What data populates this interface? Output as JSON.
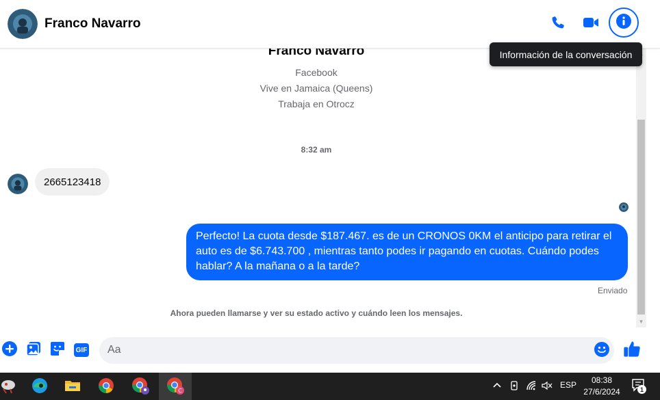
{
  "header": {
    "contact_name": "Franco Navarro",
    "tooltip": "Información de la conversación",
    "icons": [
      "phone-icon",
      "video-icon",
      "info-icon"
    ]
  },
  "profile": {
    "name": "Franco Navarro",
    "lines": [
      "Facebook",
      "Vive en Jamaica (Queens)",
      "Trabaja en Otrocz"
    ]
  },
  "conversation": {
    "timestamp": "8:32 am",
    "received_message": "2665123418",
    "sent_message": "Perfecto! La cuota desde $187.467. es de un CRONOS 0KM el anticipo para retirar el auto es de $6.743.700 , mientras tanto podes ir pagando en cuotas. Cuándo podes hablar? A la mañana o a la tarde?",
    "sent_status": "Enviado",
    "notice": "Ahora pueden llamarse y ver su estado activo y cuándo leen los mensajes."
  },
  "composer": {
    "placeholder": "Aa",
    "gif_label": "GIF"
  },
  "taskbar": {
    "language": "ESP",
    "time": "08:38",
    "date": "27/6/2024",
    "notification_count": "1"
  },
  "colors": {
    "accent": "#0866ff",
    "bubble_received": "#f0f0f0",
    "taskbar": "#1f1f1f"
  }
}
